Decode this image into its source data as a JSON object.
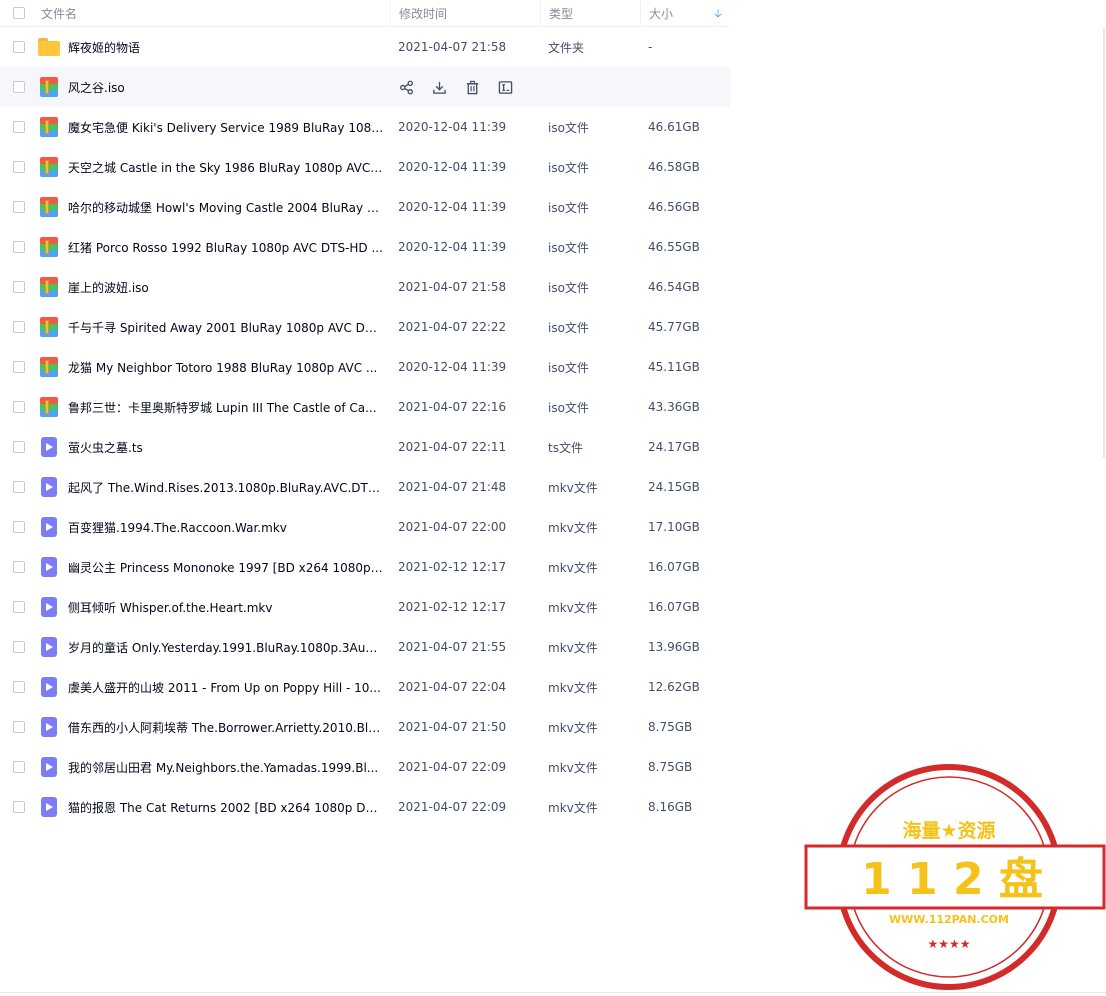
{
  "header": {
    "name": "文件名",
    "time": "修改时间",
    "type": "类型",
    "size": "大小"
  },
  "hover_row_index": 1,
  "rows": [
    {
      "icon": "folder-icon",
      "name": "辉夜姬的物语",
      "time": "2021-04-07 21:58",
      "type": "文件夹",
      "size": "-"
    },
    {
      "icon": "iso-file-icon",
      "name": "风之谷.iso",
      "time": "",
      "type": "",
      "size": ""
    },
    {
      "icon": "iso-file-icon",
      "name": "魔女宅急便 Kiki's Delivery Service 1989 BluRay 1080p...",
      "time": "2020-12-04 11:39",
      "type": "iso文件",
      "size": "46.61GB"
    },
    {
      "icon": "iso-file-icon",
      "name": "天空之城 Castle in the Sky 1986 BluRay 1080p AVC ...",
      "time": "2020-12-04 11:39",
      "type": "iso文件",
      "size": "46.58GB"
    },
    {
      "icon": "iso-file-icon",
      "name": "哈尔的移动城堡 Howl's Moving Castle 2004 BluRay 1...",
      "time": "2020-12-04 11:39",
      "type": "iso文件",
      "size": "46.56GB"
    },
    {
      "icon": "iso-file-icon",
      "name": "红猪 Porco Rosso 1992 BluRay 1080p AVC DTS-HD ...",
      "time": "2020-12-04 11:39",
      "type": "iso文件",
      "size": "46.55GB"
    },
    {
      "icon": "iso-file-icon",
      "name": "崖上的波妞.iso",
      "time": "2021-04-07 21:58",
      "type": "iso文件",
      "size": "46.54GB"
    },
    {
      "icon": "iso-file-icon",
      "name": "千与千寻 Spirited Away 2001 BluRay 1080p AVC DTS...",
      "time": "2021-04-07 22:22",
      "type": "iso文件",
      "size": "45.77GB"
    },
    {
      "icon": "iso-file-icon",
      "name": "龙猫 My Neighbor Totoro 1988 BluRay 1080p AVC ...",
      "time": "2020-12-04 11:39",
      "type": "iso文件",
      "size": "45.11GB"
    },
    {
      "icon": "iso-file-icon",
      "name": "鲁邦三世：卡里奥斯特罗城  Lupin III The Castle of Ca...",
      "time": "2021-04-07 22:16",
      "type": "iso文件",
      "size": "43.36GB"
    },
    {
      "icon": "video-file-icon",
      "name": "萤火虫之墓.ts",
      "time": "2021-04-07 22:11",
      "type": "ts文件",
      "size": "24.17GB"
    },
    {
      "icon": "video-file-icon",
      "name": "起风了 The.Wind.Rises.2013.1080p.BluRay.AVC.DTS-...",
      "time": "2021-04-07 21:48",
      "type": "mkv文件",
      "size": "24.15GB"
    },
    {
      "icon": "video-file-icon",
      "name": "百变狸猫.1994.The.Raccoon.War.mkv",
      "time": "2021-04-07 22:00",
      "type": "mkv文件",
      "size": "17.10GB"
    },
    {
      "icon": "video-file-icon",
      "name": "幽灵公主 Princess Mononoke 1997 [BD x264 1080p ...",
      "time": "2021-02-12 12:17",
      "type": "mkv文件",
      "size": "16.07GB"
    },
    {
      "icon": "video-file-icon",
      "name": "侧耳倾听 Whisper.of.the.Heart.mkv",
      "time": "2021-02-12 12:17",
      "type": "mkv文件",
      "size": "16.07GB"
    },
    {
      "icon": "video-file-icon",
      "name": "岁月的童话 Only.Yesterday.1991.BluRay.1080p.3Audi...",
      "time": "2021-04-07 21:55",
      "type": "mkv文件",
      "size": "13.96GB"
    },
    {
      "icon": "video-file-icon",
      "name": "虞美人盛开的山坡 2011 - From Up on Poppy Hill - 10...",
      "time": "2021-04-07 22:04",
      "type": "mkv文件",
      "size": "12.62GB"
    },
    {
      "icon": "video-file-icon",
      "name": "借东西的小人阿莉埃蒂 The.Borrower.Arrietty.2010.Blu...",
      "time": "2021-04-07 21:50",
      "type": "mkv文件",
      "size": "8.75GB"
    },
    {
      "icon": "video-file-icon",
      "name": "我的邻居山田君  My.Neighbors.the.Yamadas.1999.Bl...",
      "time": "2021-04-07 22:09",
      "type": "mkv文件",
      "size": "8.75GB"
    },
    {
      "icon": "video-file-icon",
      "name": "猫的报恩 The Cat Returns 2002 [BD x264 1080p DTS...",
      "time": "2021-04-07 22:09",
      "type": "mkv文件",
      "size": "8.16GB"
    }
  ],
  "row_actions": [
    "share-icon",
    "download-icon",
    "delete-icon",
    "rename-icon"
  ],
  "watermark": {
    "top_text": "海量★资源",
    "main_text": "1 1 2 盘",
    "url_text": "WWW.112PAN.COM",
    "stars": "★★★★",
    "red": "#d32a2a",
    "yellow": "#f5c21b"
  }
}
